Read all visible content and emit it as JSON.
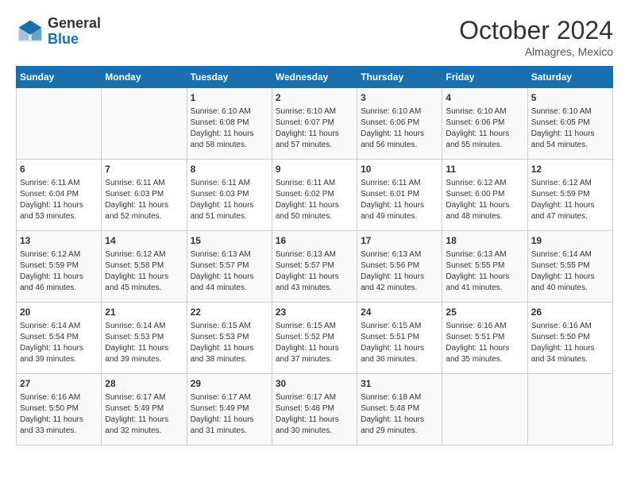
{
  "header": {
    "logo": {
      "line1": "General",
      "line2": "Blue"
    },
    "title": "October 2024",
    "location": "Almagres, Mexico"
  },
  "weekdays": [
    "Sunday",
    "Monday",
    "Tuesday",
    "Wednesday",
    "Thursday",
    "Friday",
    "Saturday"
  ],
  "weeks": [
    [
      {
        "day": "",
        "content": ""
      },
      {
        "day": "",
        "content": ""
      },
      {
        "day": "1",
        "content": "Sunrise: 6:10 AM\nSunset: 6:08 PM\nDaylight: 11 hours and 58 minutes."
      },
      {
        "day": "2",
        "content": "Sunrise: 6:10 AM\nSunset: 6:07 PM\nDaylight: 11 hours and 57 minutes."
      },
      {
        "day": "3",
        "content": "Sunrise: 6:10 AM\nSunset: 6:06 PM\nDaylight: 11 hours and 56 minutes."
      },
      {
        "day": "4",
        "content": "Sunrise: 6:10 AM\nSunset: 6:06 PM\nDaylight: 11 hours and 55 minutes."
      },
      {
        "day": "5",
        "content": "Sunrise: 6:10 AM\nSunset: 6:05 PM\nDaylight: 11 hours and 54 minutes."
      }
    ],
    [
      {
        "day": "6",
        "content": "Sunrise: 6:11 AM\nSunset: 6:04 PM\nDaylight: 11 hours and 53 minutes."
      },
      {
        "day": "7",
        "content": "Sunrise: 6:11 AM\nSunset: 6:03 PM\nDaylight: 11 hours and 52 minutes."
      },
      {
        "day": "8",
        "content": "Sunrise: 6:11 AM\nSunset: 6:03 PM\nDaylight: 11 hours and 51 minutes."
      },
      {
        "day": "9",
        "content": "Sunrise: 6:11 AM\nSunset: 6:02 PM\nDaylight: 11 hours and 50 minutes."
      },
      {
        "day": "10",
        "content": "Sunrise: 6:11 AM\nSunset: 6:01 PM\nDaylight: 11 hours and 49 minutes."
      },
      {
        "day": "11",
        "content": "Sunrise: 6:12 AM\nSunset: 6:00 PM\nDaylight: 11 hours and 48 minutes."
      },
      {
        "day": "12",
        "content": "Sunrise: 6:12 AM\nSunset: 5:59 PM\nDaylight: 11 hours and 47 minutes."
      }
    ],
    [
      {
        "day": "13",
        "content": "Sunrise: 6:12 AM\nSunset: 5:59 PM\nDaylight: 11 hours and 46 minutes."
      },
      {
        "day": "14",
        "content": "Sunrise: 6:12 AM\nSunset: 5:58 PM\nDaylight: 11 hours and 45 minutes."
      },
      {
        "day": "15",
        "content": "Sunrise: 6:13 AM\nSunset: 5:57 PM\nDaylight: 11 hours and 44 minutes."
      },
      {
        "day": "16",
        "content": "Sunrise: 6:13 AM\nSunset: 5:57 PM\nDaylight: 11 hours and 43 minutes."
      },
      {
        "day": "17",
        "content": "Sunrise: 6:13 AM\nSunset: 5:56 PM\nDaylight: 11 hours and 42 minutes."
      },
      {
        "day": "18",
        "content": "Sunrise: 6:13 AM\nSunset: 5:55 PM\nDaylight: 11 hours and 41 minutes."
      },
      {
        "day": "19",
        "content": "Sunrise: 6:14 AM\nSunset: 5:55 PM\nDaylight: 11 hours and 40 minutes."
      }
    ],
    [
      {
        "day": "20",
        "content": "Sunrise: 6:14 AM\nSunset: 5:54 PM\nDaylight: 11 hours and 39 minutes."
      },
      {
        "day": "21",
        "content": "Sunrise: 6:14 AM\nSunset: 5:53 PM\nDaylight: 11 hours and 39 minutes."
      },
      {
        "day": "22",
        "content": "Sunrise: 6:15 AM\nSunset: 5:53 PM\nDaylight: 11 hours and 38 minutes."
      },
      {
        "day": "23",
        "content": "Sunrise: 6:15 AM\nSunset: 5:52 PM\nDaylight: 11 hours and 37 minutes."
      },
      {
        "day": "24",
        "content": "Sunrise: 6:15 AM\nSunset: 5:51 PM\nDaylight: 11 hours and 36 minutes."
      },
      {
        "day": "25",
        "content": "Sunrise: 6:16 AM\nSunset: 5:51 PM\nDaylight: 11 hours and 35 minutes."
      },
      {
        "day": "26",
        "content": "Sunrise: 6:16 AM\nSunset: 5:50 PM\nDaylight: 11 hours and 34 minutes."
      }
    ],
    [
      {
        "day": "27",
        "content": "Sunrise: 6:16 AM\nSunset: 5:50 PM\nDaylight: 11 hours and 33 minutes."
      },
      {
        "day": "28",
        "content": "Sunrise: 6:17 AM\nSunset: 5:49 PM\nDaylight: 11 hours and 32 minutes."
      },
      {
        "day": "29",
        "content": "Sunrise: 6:17 AM\nSunset: 5:49 PM\nDaylight: 11 hours and 31 minutes."
      },
      {
        "day": "30",
        "content": "Sunrise: 6:17 AM\nSunset: 5:48 PM\nDaylight: 11 hours and 30 minutes."
      },
      {
        "day": "31",
        "content": "Sunrise: 6:18 AM\nSunset: 5:48 PM\nDaylight: 11 hours and 29 minutes."
      },
      {
        "day": "",
        "content": ""
      },
      {
        "day": "",
        "content": ""
      }
    ]
  ]
}
